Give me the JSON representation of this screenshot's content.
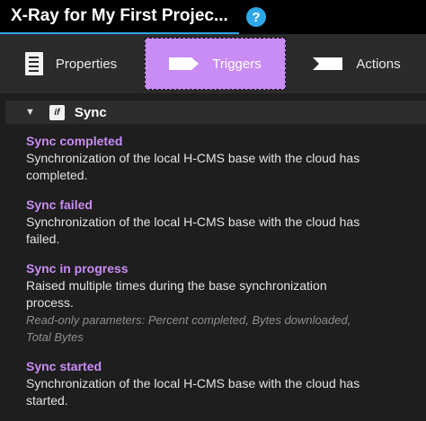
{
  "header": {
    "title": "X-Ray for My First Projec...",
    "help_label": "?",
    "accent_color": "#2ea8e6"
  },
  "tabs": [
    {
      "label": "Properties",
      "icon": "document-icon",
      "selected": false
    },
    {
      "label": "Triggers",
      "icon": "tag-icon",
      "selected": true
    },
    {
      "label": "Actions",
      "icon": "tag-icon",
      "selected": false
    }
  ],
  "selected_color": "#c98cf5",
  "section": {
    "title": "Sync",
    "icon_text": "if",
    "expanded": true,
    "icon": "chevron-down-icon"
  },
  "items": [
    {
      "title": "Sync completed",
      "desc_lines": [
        "Synchronization of the local H-CMS base with the cloud has",
        "completed."
      ]
    },
    {
      "title": "Sync failed",
      "desc_lines": [
        "Synchronization of the local H-CMS base with the cloud has",
        "failed."
      ]
    },
    {
      "title": "Sync in progress",
      "desc_lines": [
        "Raised multiple times during the base synchronization",
        "process."
      ],
      "note_lines": [
        "Read-only parameters: Percent completed, Bytes downloaded,",
        "Total Bytes"
      ]
    },
    {
      "title": "Sync started",
      "desc_lines": [
        "Synchronization of the local H-CMS base with the cloud has",
        "started."
      ]
    }
  ]
}
